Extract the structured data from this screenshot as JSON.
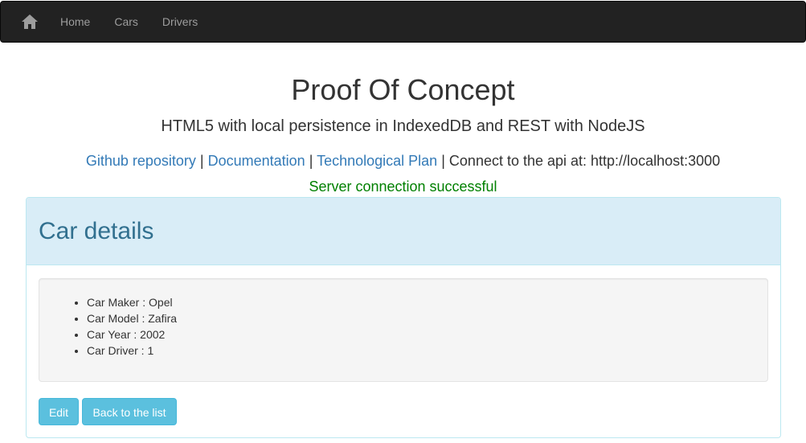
{
  "navbar": {
    "home_icon": "home-icon",
    "links": [
      "Home",
      "Cars",
      "Drivers"
    ]
  },
  "header": {
    "title": "Proof Of Concept",
    "subtitle": "HTML5 with local persistence in IndexedDB and REST with NodeJS",
    "links": {
      "github": "Github repository",
      "documentation": "Documentation",
      "tech_plan": "Technological Plan",
      "separator": "|",
      "api_text": "Connect to the api at: http://localhost:3000"
    },
    "status": "Server connection successful"
  },
  "panel": {
    "title": "Car details",
    "details": [
      "Car Maker : Opel",
      "Car Model : Zafira",
      "Car Year : 2002",
      "Car Driver : 1"
    ],
    "buttons": {
      "edit": "Edit",
      "back": "Back to the list"
    }
  },
  "colors": {
    "navbar_bg": "#222222",
    "link": "#337ab7",
    "success": "#008000",
    "panel_heading_bg": "#d9edf7",
    "panel_title": "#31708f",
    "button_info": "#5bc0de"
  }
}
